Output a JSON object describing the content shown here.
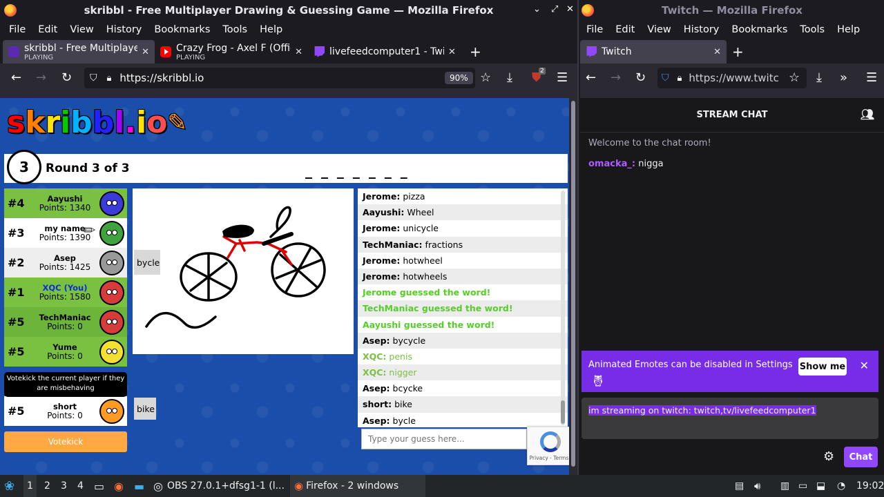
{
  "left_window": {
    "title": "skribbl - Free Multiplayer Drawing & Guessing Game — Mozilla Firefox",
    "menu": [
      "File",
      "Edit",
      "View",
      "History",
      "Bookmarks",
      "Tools",
      "Help"
    ],
    "tabs": [
      {
        "title": "skribbl - Free Multiplayer",
        "status": "PLAYING",
        "icon": "skribbl-favicon",
        "active": true
      },
      {
        "title": "Crazy Frog - Axel F (Offic",
        "status": "PLAYING",
        "icon": "youtube-favicon",
        "active": false
      },
      {
        "title": "livefeedcomputer1 - Twit",
        "status": "",
        "icon": "twitch-favicon",
        "active": false
      }
    ],
    "url": "https://skribbl.io",
    "zoom": "90%",
    "ublock_badge": "2"
  },
  "skribbl": {
    "logo": "skribbl.io",
    "round_number": "3",
    "round_text": "Round 3 of 3",
    "word_hint": "_ _ _ _ _ _ _",
    "players": [
      {
        "rank": "#4",
        "name": "Aayushi",
        "points": "Points: 1340",
        "style": "guessed",
        "avatar_color": "#3b3bd9"
      },
      {
        "rank": "#3",
        "name": "my name",
        "points": "Points: 1390",
        "style": "odd",
        "avatar_color": "#3fa33f",
        "drawing": true
      },
      {
        "rank": "#2",
        "name": "Asep",
        "points": "Points: 1425",
        "style": "even",
        "avatar_color": "#999999"
      },
      {
        "rank": "#1",
        "name": "XQC (You)",
        "points": "Points: 1580",
        "style": "guessed",
        "avatar_color": "#d83b3b",
        "you": true
      },
      {
        "rank": "#5",
        "name": "TechManiac",
        "points": "Points: 0",
        "style": "guessed2",
        "avatar_color": "#d83b3b"
      },
      {
        "rank": "#5",
        "name": "Yume",
        "points": "Points: 0",
        "style": "guessed",
        "avatar_color": "#f3e030"
      },
      {
        "rank": "#5",
        "name": "short",
        "points": "Points: 0",
        "style": "odd",
        "avatar_color": "#ff9a22"
      }
    ],
    "tooltip": "Votekick the current player if they are misbehaving",
    "votekick_label": "Votekick",
    "bubble_asep": "bycle",
    "bubble_short": "bike",
    "chat": [
      {
        "user": "Jerome:",
        "text": "pizza",
        "kind": "normal"
      },
      {
        "user": "Aayushi:",
        "text": "Wheel",
        "kind": "normal"
      },
      {
        "user": "Jerome:",
        "text": "unicycle",
        "kind": "normal"
      },
      {
        "user": "TechManiac:",
        "text": "fractions",
        "kind": "normal"
      },
      {
        "user": "Jerome:",
        "text": "hotwheel",
        "kind": "normal"
      },
      {
        "user": "Jerome:",
        "text": "hotwheels",
        "kind": "normal"
      },
      {
        "user": "",
        "text": "Jerome guessed the word!",
        "kind": "green"
      },
      {
        "user": "",
        "text": "TechManiac guessed the word!",
        "kind": "green"
      },
      {
        "user": "",
        "text": "Aayushi guessed the word!",
        "kind": "green"
      },
      {
        "user": "Asep:",
        "text": "bycycle",
        "kind": "normal"
      },
      {
        "user": "XQC:",
        "text": "penis",
        "kind": "close"
      },
      {
        "user": "XQC:",
        "text": "nigger",
        "kind": "close"
      },
      {
        "user": "Asep:",
        "text": "bcycke",
        "kind": "normal"
      },
      {
        "user": "short:",
        "text": "bike",
        "kind": "normal"
      },
      {
        "user": "Asep:",
        "text": "bycle",
        "kind": "normal"
      }
    ],
    "guess_placeholder": "Type your guess here...",
    "recaptcha_text": "Privacy - Terms"
  },
  "right_window": {
    "title": "Twitch — Mozilla Firefox",
    "menu": [
      "File",
      "Edit",
      "View",
      "History",
      "Bookmarks",
      "Tools",
      "Help"
    ],
    "tab": "Twitch",
    "url": "https://www.twitc",
    "stream_chat_title": "STREAM CHAT",
    "welcome": "Welcome to the chat room!",
    "message_user": "omacka_:",
    "message_text": "nigga",
    "banner_text": "Animated Emotes can be disabled in Settings",
    "banner_button": "Show me",
    "input_text": "im streaming on twitch: twitch,tv/livefeedcomputer1",
    "chat_button": "Chat"
  },
  "taskbar": {
    "workspaces": [
      "1",
      "2",
      "3",
      "4"
    ],
    "obs_label": "OBS 27.0.1+dfsg1-1 (l...",
    "firefox_label": "Firefox - 2 windows",
    "clock": "19:02"
  }
}
